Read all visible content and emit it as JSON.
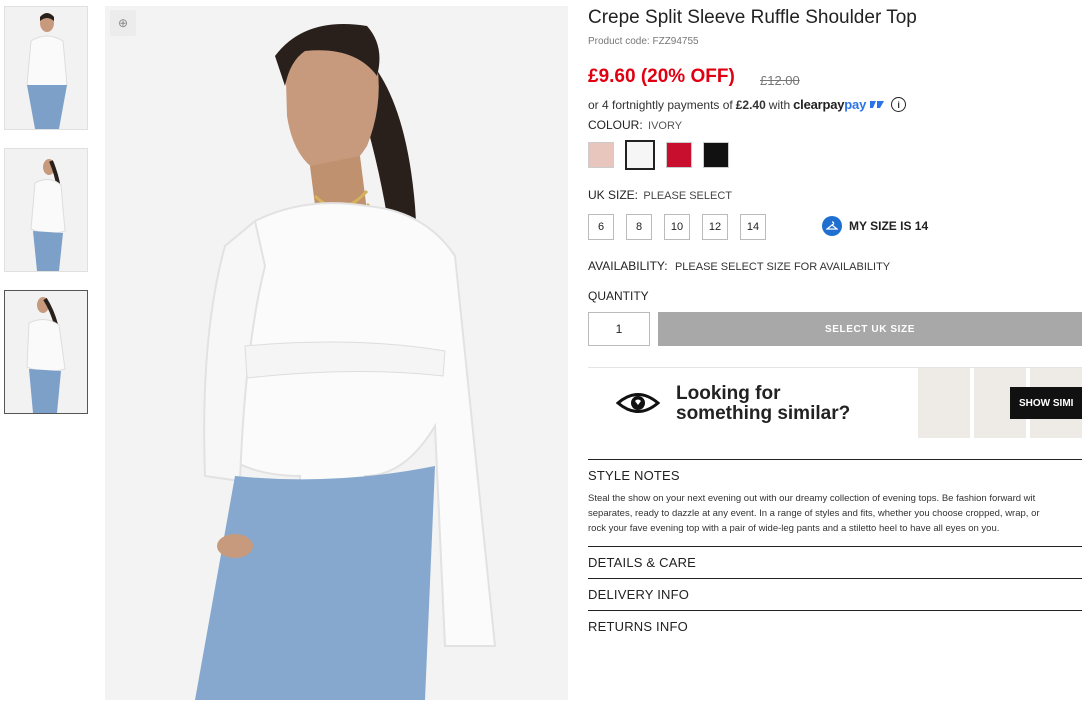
{
  "product": {
    "title": "Crepe Split Sleeve Ruffle Shoulder Top",
    "code": "Product code: FZZ94755",
    "price": "£9.60 (20% OFF)",
    "old_price": "£12.00"
  },
  "clearpay": {
    "prefix": "or 4 fortnightly payments of",
    "amount": "£2.40",
    "with": "with",
    "brand": "clearpay",
    "info_icon": "info-icon"
  },
  "colour": {
    "label": "COLOUR:",
    "selected": "IVORY",
    "swatches": [
      {
        "name": "blush",
        "color": "#e8c6bd"
      },
      {
        "name": "ivory",
        "color": "#f6f6f6"
      },
      {
        "name": "red",
        "color": "#c8102e"
      },
      {
        "name": "black",
        "color": "#111111"
      }
    ]
  },
  "size": {
    "label": "UK SIZE:",
    "value": "PLEASE SELECT",
    "options": [
      "6",
      "8",
      "10",
      "12",
      "14"
    ],
    "my_size": "MY SIZE IS 14"
  },
  "availability": {
    "label": "AVAILABILITY:",
    "value": "PLEASE SELECT SIZE FOR AVAILABILITY"
  },
  "quantity": {
    "label": "QUANTITY",
    "value": "1"
  },
  "cta": {
    "label": "SELECT UK SIZE"
  },
  "similar": {
    "line1": "Looking for",
    "line2": "something similar?",
    "button": "SHOW SIMI"
  },
  "sections": {
    "style_notes": "STYLE NOTES",
    "style_notes_lines": [
      "Steal the show on your next evening out with our dreamy collection of evening tops. Be fashion forward wit",
      "separates, ready to dazzle at any event. In a range of styles and fits, whether you choose cropped, wrap, or",
      "rock your fave evening top with a pair of wide-leg pants and a stiletto heel to have all eyes on you."
    ],
    "details": "DETAILS & CARE",
    "delivery": "DELIVERY INFO",
    "returns": "RETURNS INFO"
  }
}
